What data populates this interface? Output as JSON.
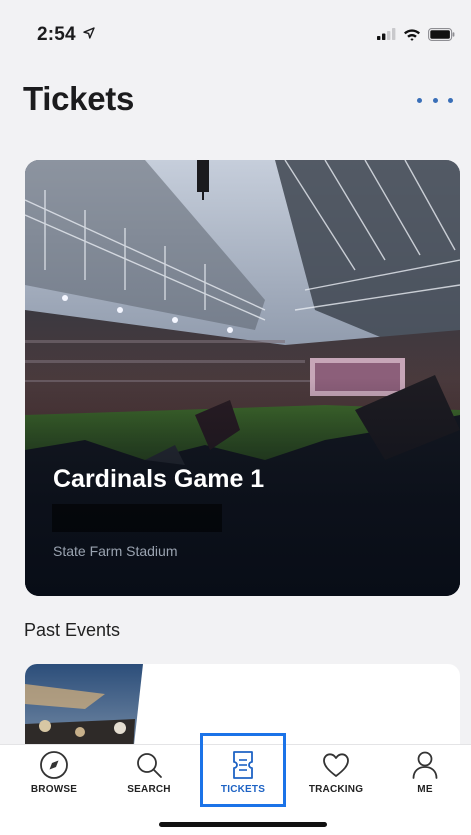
{
  "status_bar": {
    "time": "2:54",
    "location_icon": "location-arrow-icon",
    "signal_icon": "cellular-signal-icon",
    "wifi_icon": "wifi-icon",
    "battery_icon": "battery-icon"
  },
  "header": {
    "title": "Tickets",
    "more_icon": "more-dots-icon"
  },
  "event": {
    "title": "Cardinals Game 1",
    "venue": "State Farm Stadium"
  },
  "past_events": {
    "title": "Past Events"
  },
  "tab_bar": {
    "active": "tickets",
    "accent_color": "#1e63c4",
    "tabs": [
      {
        "id": "browse",
        "label": "BROWSE",
        "icon": "compass-icon"
      },
      {
        "id": "search",
        "label": "SEARCH",
        "icon": "search-icon"
      },
      {
        "id": "tickets",
        "label": "TICKETS",
        "icon": "ticket-icon"
      },
      {
        "id": "tracking",
        "label": "TRACKING",
        "icon": "heart-icon"
      },
      {
        "id": "me",
        "label": "ME",
        "icon": "person-icon"
      }
    ]
  }
}
